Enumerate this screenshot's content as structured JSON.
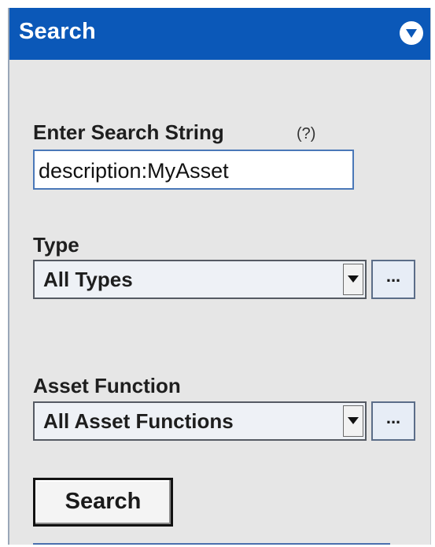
{
  "panel": {
    "title": "Search",
    "collapse_icon": "chevron-down-icon"
  },
  "search_string": {
    "label": "Enter Search String",
    "help": "(?)",
    "value": "description:MyAsset"
  },
  "type": {
    "label": "Type",
    "selected": "All Types",
    "browse_label": "..."
  },
  "asset_function": {
    "label": "Asset Function",
    "selected": "All Asset Functions",
    "browse_label": "..."
  },
  "search_button_label": "Search",
  "colors": {
    "header": "#0b58b8",
    "panel_bg": "#e6e6e6",
    "input_border": "#4a78b8"
  }
}
